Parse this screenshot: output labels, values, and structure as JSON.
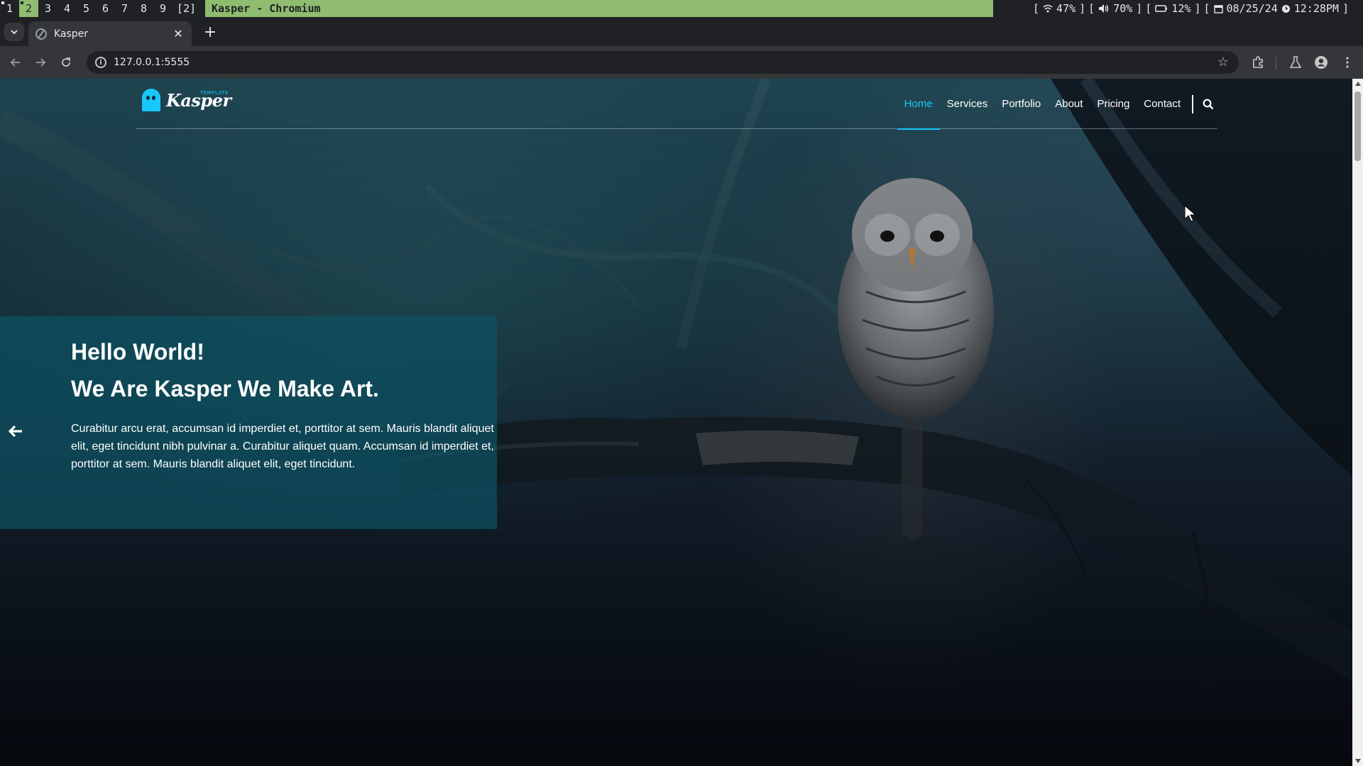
{
  "wm": {
    "workspaces": [
      "1",
      "2",
      "3",
      "4",
      "5",
      "6",
      "7",
      "8",
      "9"
    ],
    "active_workspace": "2",
    "layout_indicator": "[2]",
    "window_title": "Kasper - Chromium",
    "status": {
      "wifi": "47%",
      "volume": "70%",
      "battery": "12%",
      "date": "08/25/24",
      "time": "12:28PM"
    }
  },
  "browser": {
    "tab_title": "Kasper",
    "url": "127.0.0.1:5555",
    "icons": {
      "back": "arrow-left-icon",
      "forward": "arrow-right-icon",
      "reload": "reload-icon",
      "bookmark": "star-icon",
      "extensions": "puzzle-icon",
      "labs": "flask-icon",
      "profile": "person-icon",
      "menu": "kebab-icon"
    }
  },
  "site": {
    "logo": {
      "text": "Kasper",
      "small": "TEMPLATE"
    },
    "nav": [
      "Home",
      "Services",
      "Portfolio",
      "About",
      "Pricing",
      "Contact"
    ],
    "active_nav": "Home",
    "accent_color": "#19c8fa",
    "hero": {
      "line1": "Hello World!",
      "line2": "We Are Kasper We Make Art.",
      "paragraph": "Curabitur arcu erat, accumsan id imperdiet et, porttitor at sem. Mauris blandit aliquet elit, eget tincidunt nibh pulvinar a. Curabitur aliquet quam. Accumsan id imperdiet et, porttitor at sem. Mauris blandit aliquet elit, eget tincidunt."
    }
  }
}
